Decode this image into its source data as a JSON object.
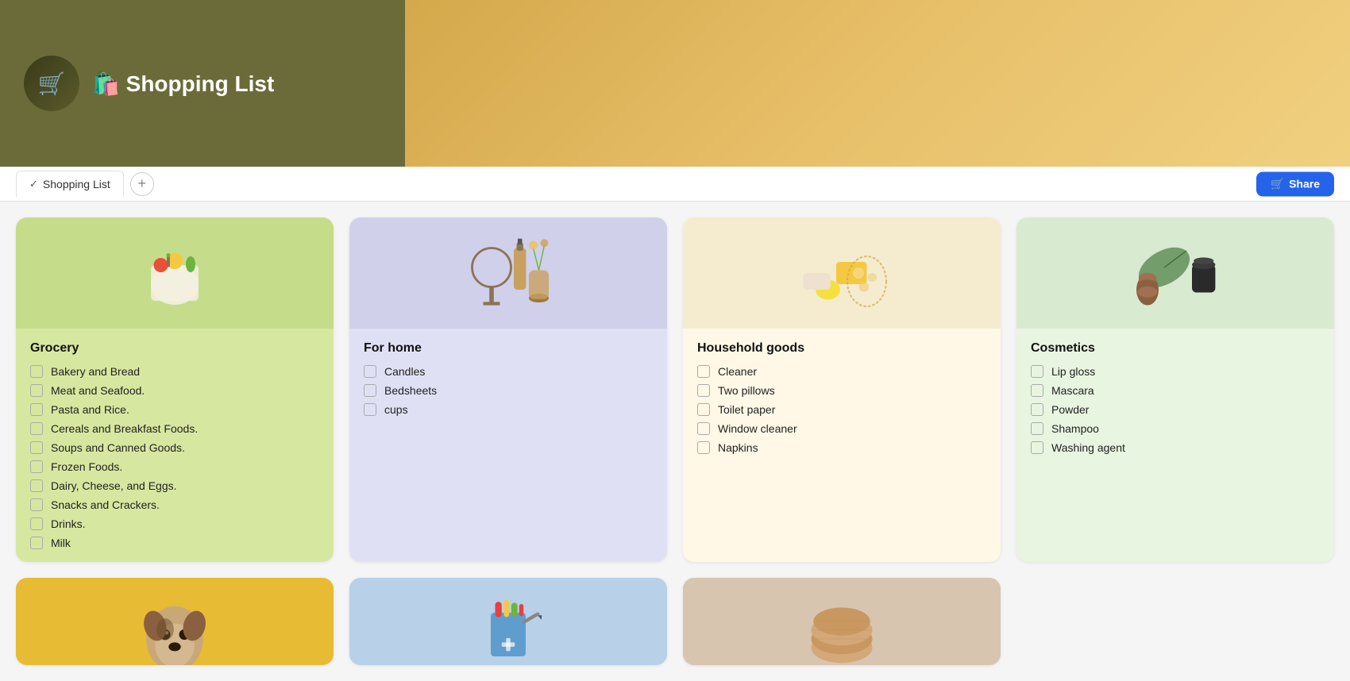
{
  "header": {
    "avatar_emoji": "🛍️",
    "title": "Shopping List",
    "title_emoji": "🛍️"
  },
  "tabs": [
    {
      "label": "Shopping List",
      "active": true
    }
  ],
  "tab_add_label": "+",
  "share_button": "Share",
  "cards": [
    {
      "id": "grocery",
      "title": "Grocery",
      "color": "grocery",
      "img_emoji": "🥦",
      "items": [
        "Bakery and Bread",
        "Meat and Seafood.",
        "Pasta and Rice.",
        "Cereals and Breakfast Foods.",
        "Soups and Canned Goods.",
        "Frozen Foods.",
        "Dairy, Cheese, and Eggs.",
        "Snacks and Crackers.",
        "Drinks.",
        "Milk"
      ]
    },
    {
      "id": "forhome",
      "title": "For home",
      "color": "forhome",
      "img_emoji": "🪔",
      "items": [
        "Candles",
        "Bedsheets",
        "cups"
      ]
    },
    {
      "id": "household",
      "title": "Household goods",
      "color": "household",
      "img_emoji": "🧽",
      "items": [
        "Cleaner",
        "Two pillows",
        "Toilet paper",
        "Window cleaner",
        "Napkins"
      ]
    },
    {
      "id": "cosmetics",
      "title": "Cosmetics",
      "color": "cosmetics",
      "img_emoji": "🌿",
      "items": [
        "Lip gloss",
        "Mascara",
        "Powder",
        "Shampoo",
        "Washing agent"
      ]
    }
  ],
  "bottom_cards": [
    {
      "id": "pets",
      "color": "pets",
      "img_emoji": "🐕"
    },
    {
      "id": "pharmacy",
      "color": "pharmacy",
      "img_emoji": "💊"
    },
    {
      "id": "knitwear",
      "color": "other",
      "img_emoji": "🧶"
    }
  ]
}
